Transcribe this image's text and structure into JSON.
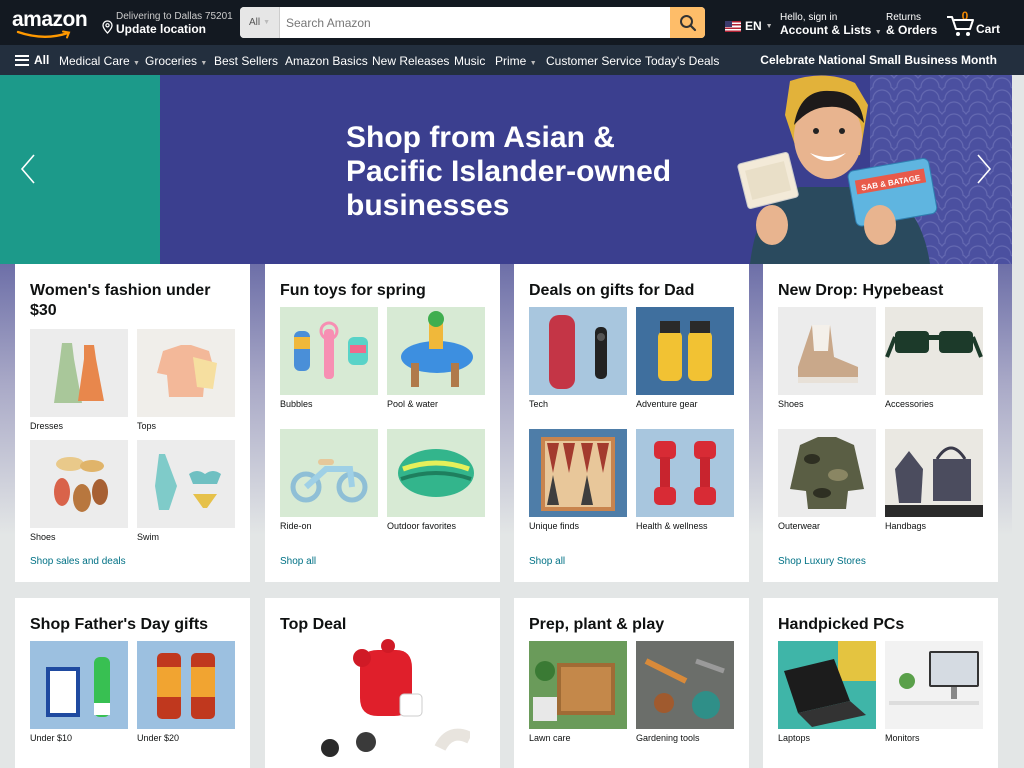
{
  "header": {
    "logo": "amazon",
    "deliver_line1": "Delivering to Dallas 75201",
    "deliver_line2": "Update location",
    "search_category": "All",
    "search_placeholder": "Search Amazon",
    "language": "EN",
    "account_line1": "Hello, sign in",
    "account_line2": "Account & Lists",
    "returns_line1": "Returns",
    "returns_line2": "& Orders",
    "cart_count": "0",
    "cart_label": "Cart"
  },
  "subnav": {
    "all_label": "All",
    "items": [
      "Medical Care",
      "Groceries",
      "Best Sellers",
      "Amazon Basics",
      "New Releases",
      "Music",
      "Prime",
      "Customer Service",
      "Today's Deals"
    ],
    "promo": "Celebrate National Small Business Month"
  },
  "hero": {
    "title": "Shop from Asian & Pacific Islander-owned businesses",
    "product_text": "SAB & BATAGE"
  },
  "cards": [
    {
      "title": "Women's fashion under $30",
      "tiles": [
        "Dresses",
        "Tops",
        "Shoes",
        "Swim"
      ],
      "link": "Shop sales and deals"
    },
    {
      "title": "Fun toys for spring",
      "tiles": [
        "Bubbles",
        "Pool & water",
        "Ride-on",
        "Outdoor favorites"
      ],
      "link": "Shop all"
    },
    {
      "title": "Deals on gifts for Dad",
      "tiles": [
        "Tech",
        "Adventure gear",
        "Unique finds",
        "Health & wellness"
      ],
      "link": "Shop all"
    },
    {
      "title": "New Drop: Hypebeast",
      "tiles": [
        "Shoes",
        "Accessories",
        "Outerwear",
        "Handbags"
      ],
      "link": "Shop Luxury Stores"
    },
    {
      "title": "Shop Father's Day gifts",
      "tiles": [
        "Under $10",
        "Under $20"
      ]
    },
    {
      "title": "Top Deal"
    },
    {
      "title": "Prep, plant & play",
      "tiles": [
        "Lawn care",
        "Gardening tools"
      ]
    },
    {
      "title": "Handpicked PCs",
      "tiles": [
        "Laptops",
        "Monitors"
      ]
    }
  ],
  "colors": {
    "nav_top": "#131921",
    "nav_sub": "#232f3e",
    "search_button": "#febd69",
    "cart_count": "#f08804",
    "link": "#007185",
    "hero_blue": "#3b3f8f",
    "hero_teal": "#1c9a8a"
  },
  "icons": [
    "location-pin-icon",
    "search-icon",
    "us-flag-icon",
    "cart-icon",
    "hamburger-icon",
    "chevron-left-icon",
    "chevron-right-icon"
  ]
}
